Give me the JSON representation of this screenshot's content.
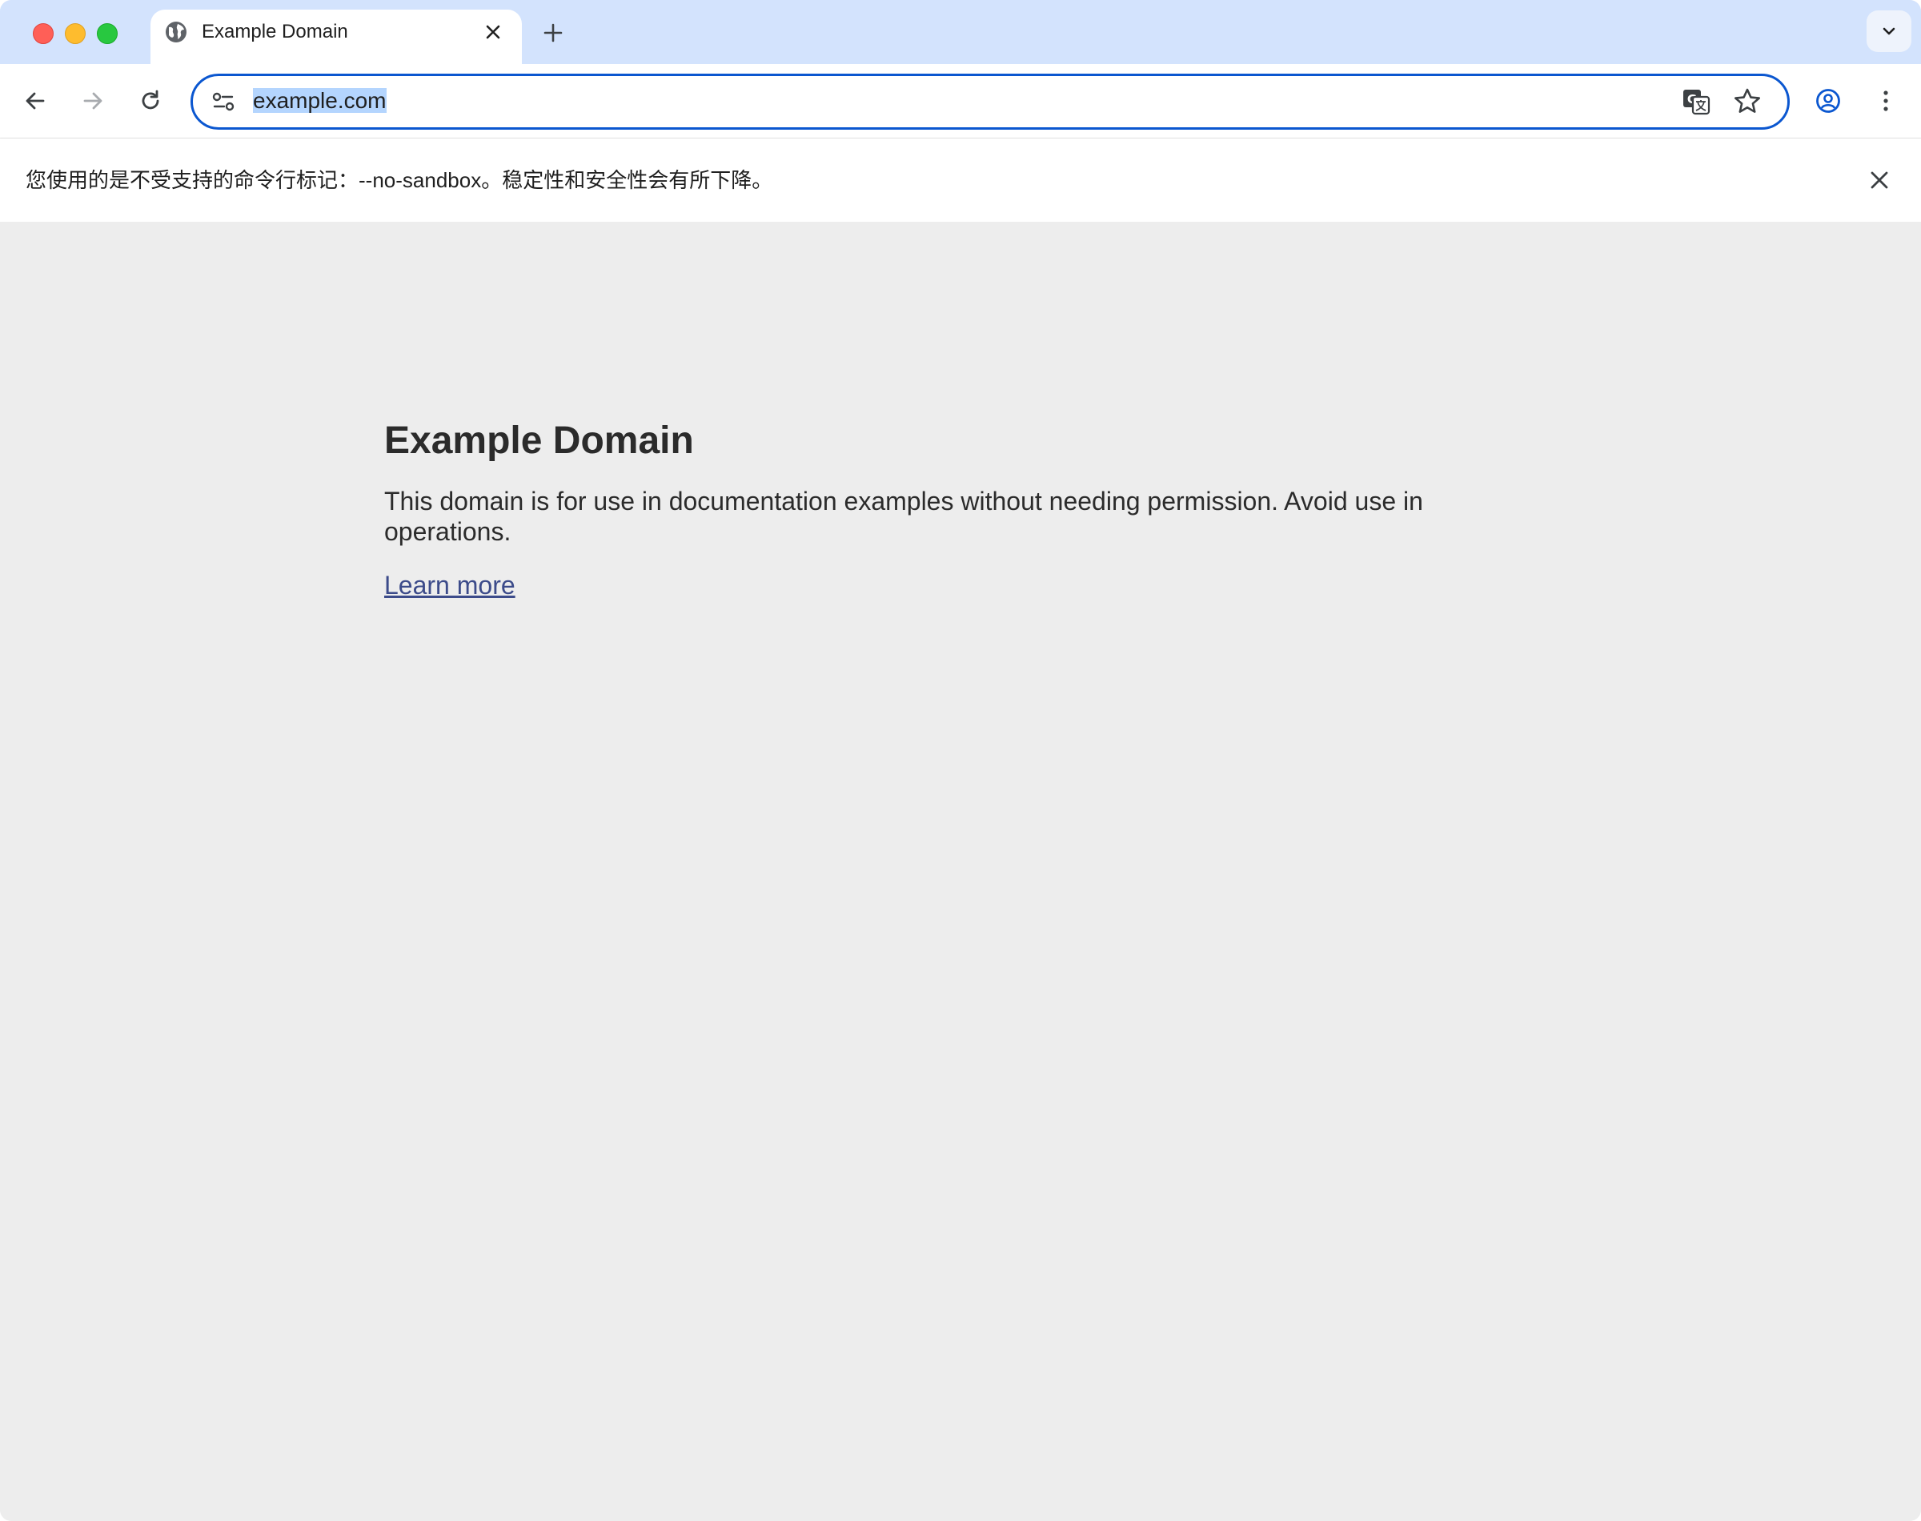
{
  "window": {
    "traffic_lights": [
      "close",
      "minimize",
      "zoom"
    ]
  },
  "tabs": [
    {
      "title": "Example Domain",
      "favicon": "globe-icon",
      "active": true
    }
  ],
  "toolbar": {
    "url": "example.com",
    "buttons": [
      "back-icon",
      "forward-icon",
      "reload-icon",
      "site-info-icon",
      "translate-icon",
      "bookmark-star-icon",
      "profile-icon",
      "menu-icon"
    ]
  },
  "infobar": {
    "message": "您使用的是不受支持的命令行标记：--no-sandbox。稳定性和安全性会有所下降。"
  },
  "page": {
    "heading": "Example Domain",
    "paragraph": "This domain is for use in documentation examples without needing permission. Avoid use in operations.",
    "link_text": "Learn more"
  },
  "colors": {
    "tabstrip": "#d3e3fd",
    "omnibox_border": "#0b57d0",
    "url_selection": "#b4d5fe",
    "page_background": "#ededed",
    "link": "#3c4b8a"
  }
}
